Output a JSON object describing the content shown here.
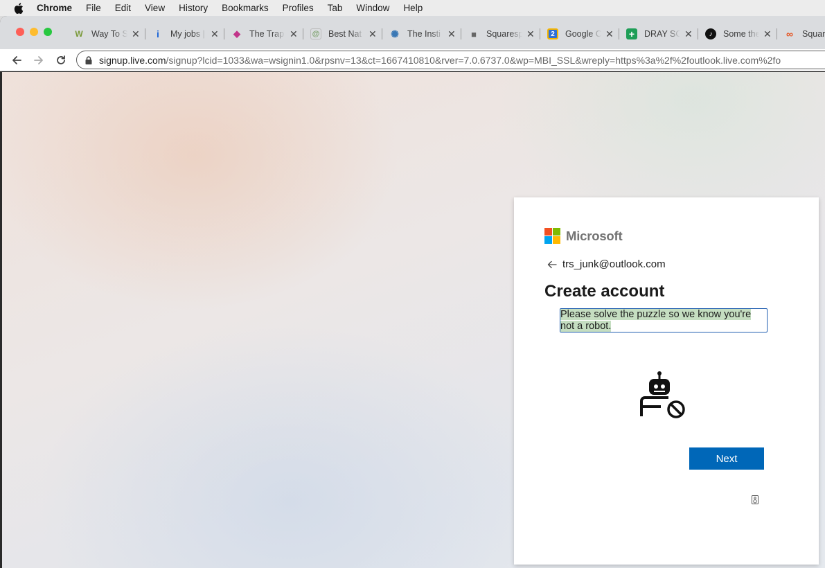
{
  "os_menubar": {
    "app_name": "Chrome",
    "items": [
      "File",
      "Edit",
      "View",
      "History",
      "Bookmarks",
      "Profiles",
      "Tab",
      "Window",
      "Help"
    ]
  },
  "browser": {
    "tabs": [
      {
        "title": "Way To S",
        "favicon": "W",
        "color": "#7a9a3a"
      },
      {
        "title": "My jobs |",
        "favicon": "i",
        "color": "#1a64d6"
      },
      {
        "title": "The Trap",
        "favicon": "◆",
        "color": "#c2358a"
      },
      {
        "title": "Best Nat",
        "favicon": "@",
        "color": "#7aa06a"
      },
      {
        "title": "The Insti",
        "favicon": "✺",
        "color": "#3a78b5"
      },
      {
        "title": "Squaresp",
        "favicon": "■",
        "color": "#666666"
      },
      {
        "title": "Google C",
        "favicon": "2",
        "color": "#2f6fd6"
      },
      {
        "title": "DRAY SC",
        "favicon": "+",
        "color": "#1e9e57"
      },
      {
        "title": "Some the",
        "favicon": "♪",
        "color": "#111111"
      },
      {
        "title": "Square",
        "favicon": "∞",
        "color": "#e5521f"
      }
    ],
    "url_host": "signup.live.com",
    "url_rest": "/signup?lcid=1033&wa=wsignin1.0&rpsnv=13&ct=1667410810&rver=7.0.6737.0&wp=MBI_SSL&wreply=https%3a%2f%2foutlook.live.com%2fo"
  },
  "card": {
    "brand": "Microsoft",
    "email": "trs_junk@outlook.com",
    "title": "Create account",
    "prompt": "Please solve the puzzle so we know you're not a robot.",
    "next_label": "Next"
  },
  "colors": {
    "accent": "#0067b8",
    "logo": [
      "#f25022",
      "#7fba00",
      "#00a4ef",
      "#ffb900"
    ]
  }
}
